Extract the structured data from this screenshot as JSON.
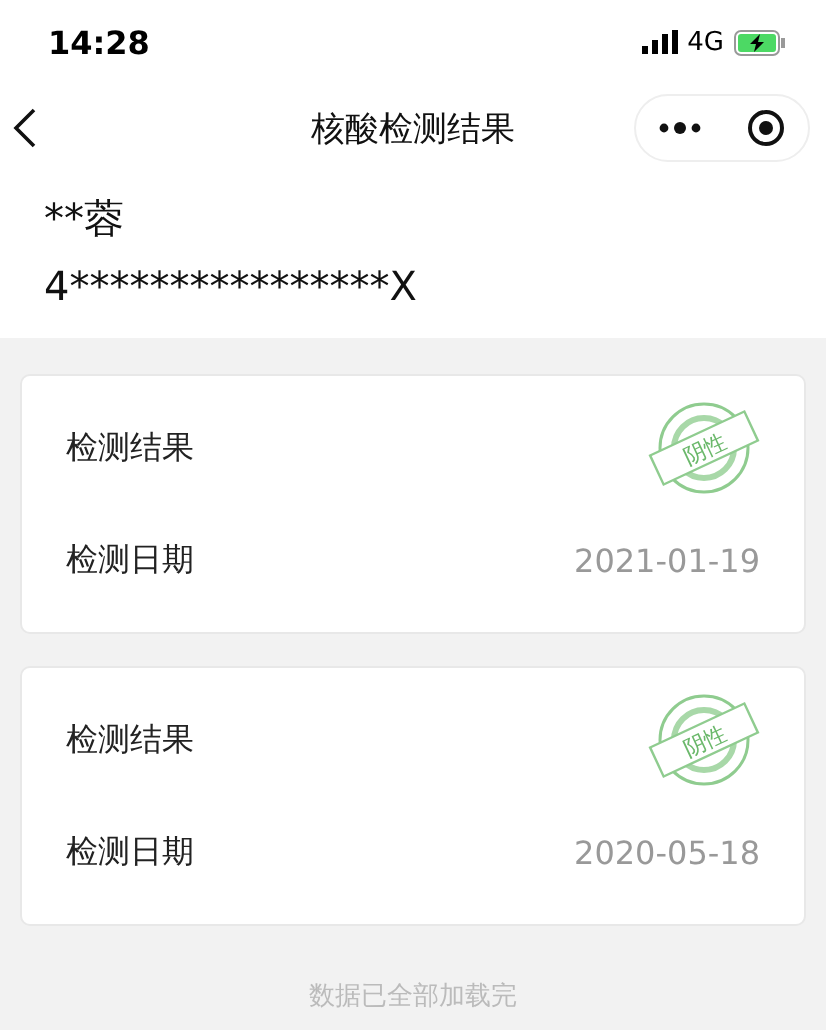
{
  "status_bar": {
    "time": "14:28",
    "network": "4G"
  },
  "nav": {
    "title": "核酸检测结果"
  },
  "person": {
    "name": "**蓉",
    "id_number": "4****************X"
  },
  "records": [
    {
      "result_label": "检测结果",
      "result": "阴性",
      "date_label": "检测日期",
      "date": "2021-01-19"
    },
    {
      "result_label": "检测结果",
      "result": "阴性",
      "date_label": "检测日期",
      "date": "2020-05-18"
    }
  ],
  "footer": "数据已全部加载完"
}
